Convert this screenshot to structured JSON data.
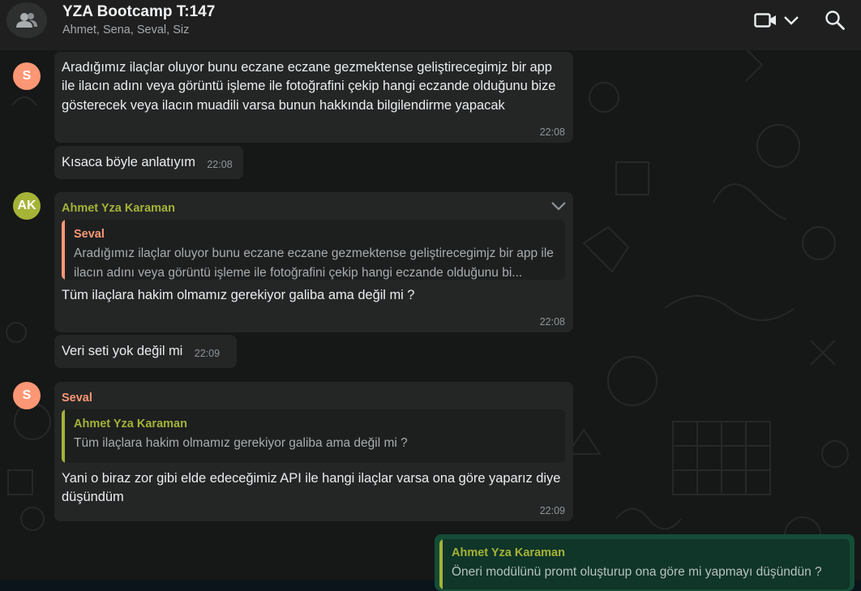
{
  "header": {
    "title": "YZA Bootcamp T:147",
    "members": "Ahmet, Sena, Seval, Siz"
  },
  "colors": {
    "seval": "#fc9775",
    "ahmet": "#a5b337",
    "bubble_in": "#242626",
    "bubble_out": "#144d37"
  },
  "avatars": {
    "seval": "S",
    "ahmet": "AK"
  },
  "messages": [
    {
      "text": "Aradığımız ilaçlar oluyor bunu eczane eczane gezmektense geliştirecegimjz bir app ile ilacın adını veya görüntü işleme ile fotoğrafini çekip hangi eczande olduğunu bize gösterecek veya ilacın muadili varsa bunun hakkında bilgilendirme yapacak",
      "time": "22:08"
    },
    {
      "text": "Kısaca böyle anlatıyım",
      "time": "22:08"
    },
    {
      "sender": "Ahmet Yza Karaman",
      "quote_name": "Seval",
      "quote_text": "Aradığımız ilaçlar oluyor bunu eczane eczane gezmektense geliştirecegimjz bir app ile ilacın adını veya görüntü işleme ile fotoğrafini çekip hangi eczande olduğunu bi...",
      "text": "Tüm ilaçlara hakim olmamız gerekiyor galiba ama değil mi ?",
      "time": "22:08"
    },
    {
      "text": "Veri seti yok değil mi",
      "time": "22:09"
    },
    {
      "sender": "Seval",
      "quote_name": "Ahmet Yza Karaman",
      "quote_text": "Tüm ilaçlara hakim olmamız gerekiyor galiba ama değil mi ?",
      "text": "Yani o biraz zor gibi elde edeceğimiz API ile hangi ilaçlar varsa ona göre yaparız diye düşündüm",
      "time": "22:09"
    },
    {
      "quote_name": "Ahmet Yza Karaman",
      "quote_text": "Öneri modülünü promt oluşturup ona göre mi yapmayı düşündün ?"
    }
  ],
  "icons": {
    "group_avatar": "group-icon",
    "video": "video-camera-icon",
    "dropdown": "chevron-down-icon",
    "search": "search-icon",
    "message_menu": "chevron-down-icon"
  }
}
